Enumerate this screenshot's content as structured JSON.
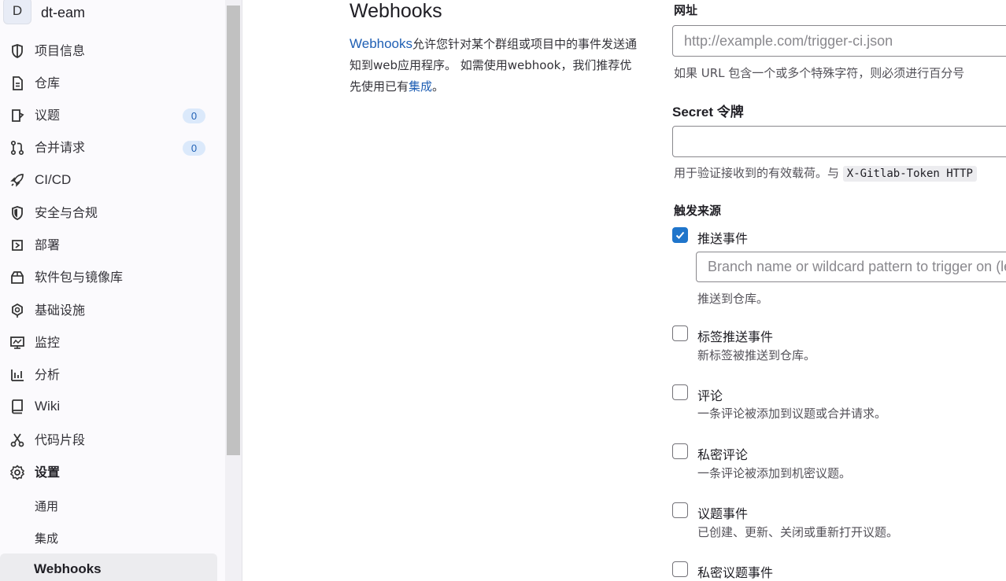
{
  "project": {
    "avatar_letter": "D",
    "name": "dt-eam"
  },
  "sidebar": {
    "items": [
      {
        "label": "项目信息",
        "icon": "project-info-icon"
      },
      {
        "label": "仓库",
        "icon": "repository-icon"
      },
      {
        "label": "议题",
        "icon": "issues-icon",
        "badge": "0"
      },
      {
        "label": "合并请求",
        "icon": "merge-request-icon",
        "badge": "0"
      },
      {
        "label": "CI/CD",
        "icon": "rocket-icon"
      },
      {
        "label": "安全与合规",
        "icon": "shield-icon"
      },
      {
        "label": "部署",
        "icon": "deploy-icon"
      },
      {
        "label": "软件包与镜像库",
        "icon": "package-icon"
      },
      {
        "label": "基础设施",
        "icon": "cloud-gear-icon"
      },
      {
        "label": "监控",
        "icon": "monitor-icon"
      },
      {
        "label": "分析",
        "icon": "chart-icon"
      },
      {
        "label": "Wiki",
        "icon": "book-icon"
      },
      {
        "label": "代码片段",
        "icon": "scissors-icon"
      },
      {
        "label": "设置",
        "icon": "gear-icon"
      }
    ],
    "settings_sub": [
      {
        "label": "通用"
      },
      {
        "label": "集成"
      },
      {
        "label": "Webhooks"
      }
    ]
  },
  "main": {
    "title": "Webhooks",
    "desc_link": "Webhooks",
    "desc_text_1": "允许您针对某个群组或项目中的事件发送通知到web应用程序。 如需使用webhook，我们推荐优先使用已有",
    "desc_link_2": "集成",
    "desc_text_2": "。",
    "url_label": "网址",
    "url_placeholder": "http://example.com/trigger-ci.json",
    "url_help": "如果 URL 包含一个或多个特殊字符，则必须进行百分号",
    "secret_label": "Secret 令牌",
    "secret_help_pre": "用于验证接收到的有效载荷。与",
    "secret_help_code": "X-Gitlab-Token HTTP",
    "trigger_label": "触发来源",
    "push": {
      "label": "推送事件",
      "checked": true,
      "branch_placeholder": "Branch name or wildcard pattern to trigger on (le",
      "help": "推送到仓库。"
    },
    "events": [
      {
        "label": "标签推送事件",
        "help": "新标签被推送到仓库。",
        "checked": false
      },
      {
        "label": "评论",
        "help": "一条评论被添加到议题或合并请求。",
        "checked": false
      },
      {
        "label": "私密评论",
        "help": "一条评论被添加到机密议题。",
        "checked": false
      },
      {
        "label": "议题事件",
        "help": "已创建、更新、关闭或重新打开议题。",
        "checked": false
      },
      {
        "label": "私密议题事件",
        "help": "",
        "checked": false
      }
    ]
  }
}
